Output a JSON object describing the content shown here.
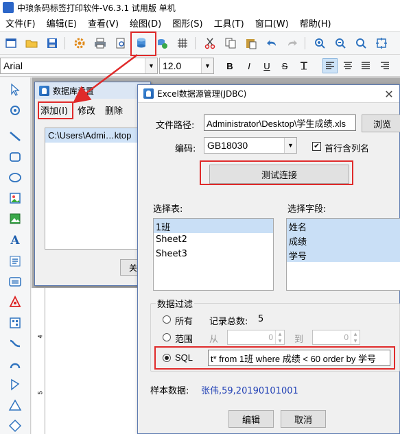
{
  "window": {
    "title": "中琅条码标签打印软件-V6.3.1 试用版 单机"
  },
  "menu": {
    "items": [
      "文件(F)",
      "编辑(E)",
      "查看(V)",
      "绘图(D)",
      "图形(S)",
      "工具(T)",
      "窗口(W)",
      "帮助(H)"
    ]
  },
  "format_toolbar": {
    "font_name": "Arial",
    "font_size": "12.0",
    "bold": "B",
    "italic": "I",
    "underline": "U",
    "strike": "S"
  },
  "db_settings_dialog": {
    "title": "数据库设置",
    "menu_add": "添加(I)",
    "menu_edit": "修改",
    "menu_delete": "删除",
    "list_row": "C:\\Users\\Admi…ktop",
    "button_partial": "关"
  },
  "excel_dialog": {
    "title": "Excel数据源管理(JDBC)",
    "close": "✕",
    "file_path_label": "文件路径:",
    "file_path_value": "Administrator\\Desktop\\学生成绩.xls",
    "browse_button": "浏览",
    "encoding_label": "编码:",
    "encoding_value": "GB18030",
    "first_row_header_label": "首行含列名",
    "first_row_header_checked": true,
    "test_connection_button": "测试连接",
    "select_table_label": "选择表:",
    "tables": [
      {
        "name": "1班",
        "selected": true
      },
      {
        "name": "Sheet2",
        "selected": false
      },
      {
        "name": "Sheet3",
        "selected": false
      }
    ],
    "select_fields_label": "选择字段:",
    "fields": [
      {
        "name": "姓名",
        "selected": true
      },
      {
        "name": "成绩",
        "selected": true
      },
      {
        "name": "学号",
        "selected": true
      }
    ],
    "filter": {
      "legend": "数据过滤",
      "all_label": "所有",
      "record_count_label": "记录总数:",
      "record_count_value": "5",
      "range_label": "范围",
      "from_label": "从",
      "from_value": "0",
      "to_label": "到",
      "to_value": "0",
      "sql_label": "SQL",
      "sql_value": "t* from 1班 where 成绩 < 60 order by 学号",
      "selected_mode": "SQL"
    },
    "sample_label": "样本数据:",
    "sample_value": "张伟,59,20190101001",
    "edit_button": "编辑",
    "cancel_button": "取消"
  },
  "ruler": {
    "marks": [
      "4",
      "5"
    ]
  },
  "colors": {
    "highlight": "#e02a2a",
    "sample_text": "#1f3fb5",
    "selection": "#c9dff6"
  }
}
